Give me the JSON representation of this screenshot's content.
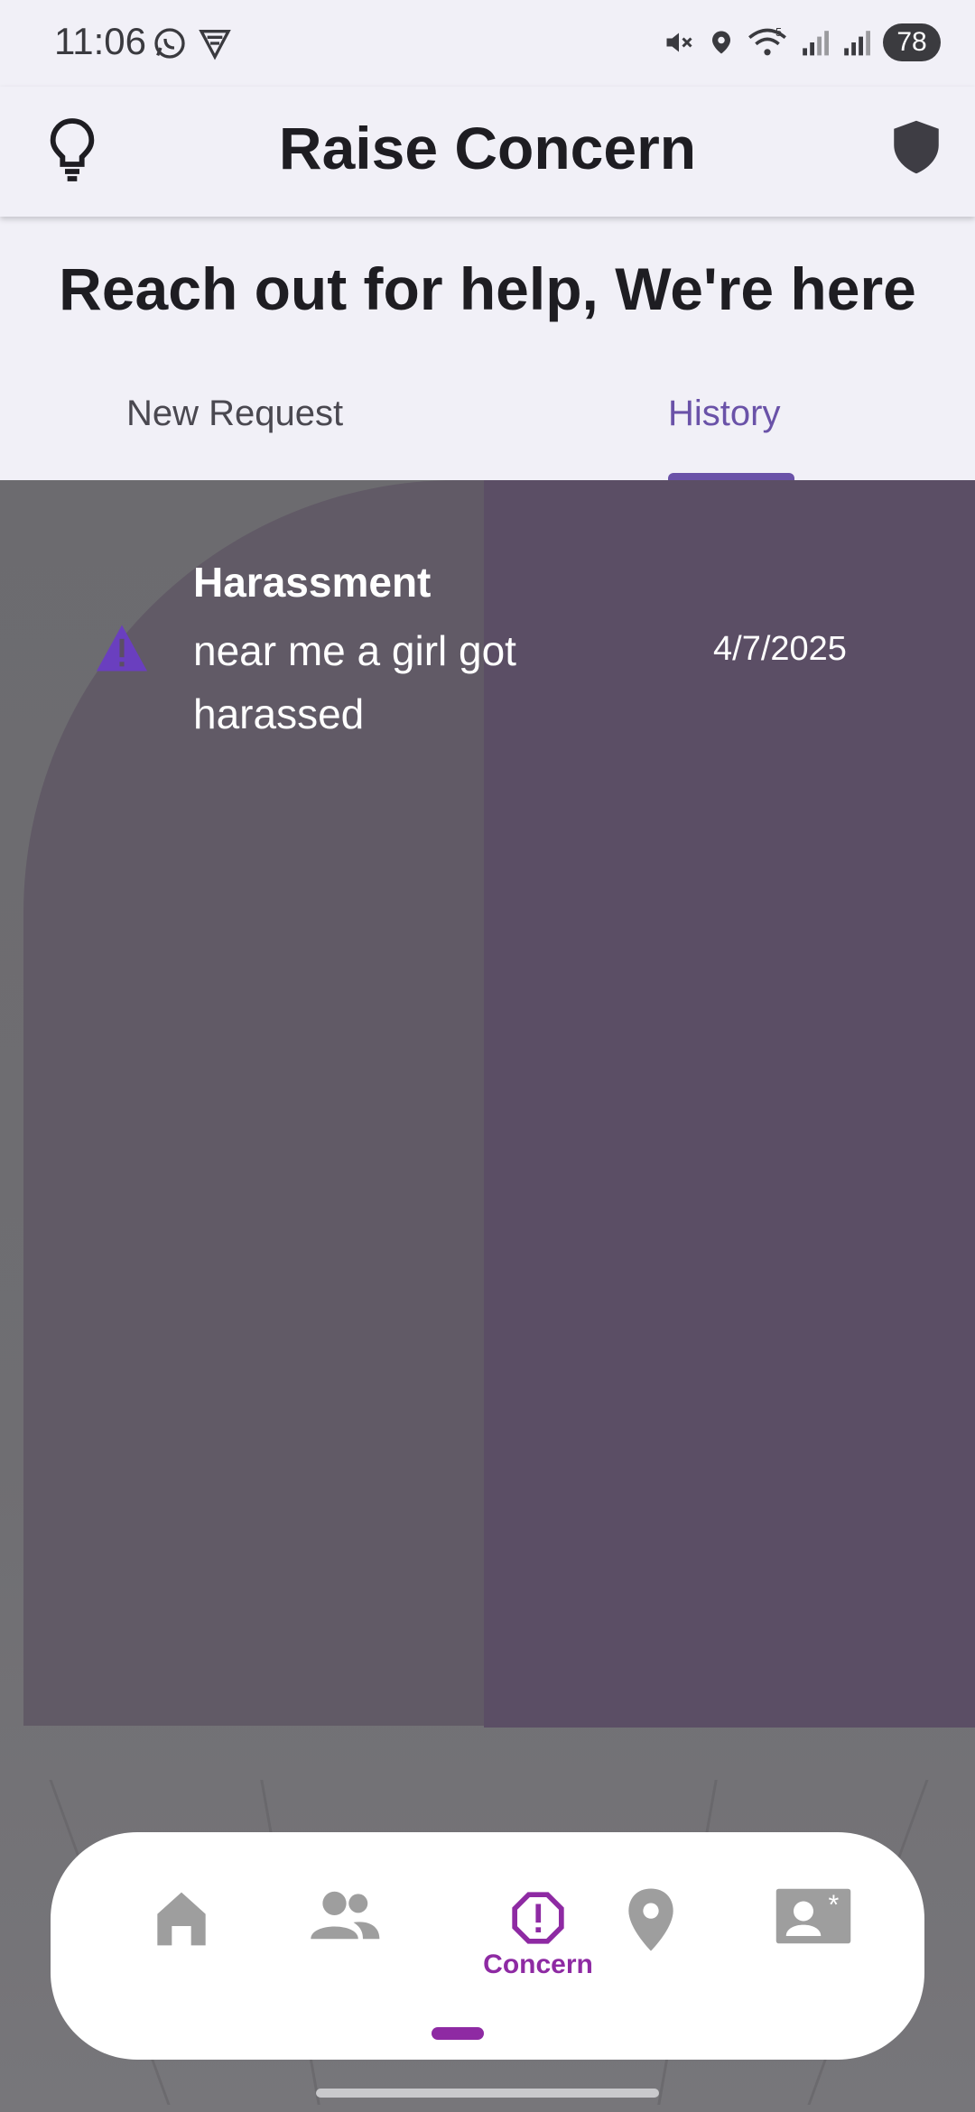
{
  "status_bar": {
    "time": "11:06",
    "battery": "78",
    "network_label": "5"
  },
  "app_bar": {
    "title": "Raise Concern"
  },
  "header": {
    "tagline": "Reach out for help, We're here"
  },
  "tabs": [
    {
      "label": "New Request",
      "selected": false
    },
    {
      "label": "History",
      "selected": true
    }
  ],
  "history": [
    {
      "category": "Harassment",
      "description": "near me a girl got harassed",
      "date": "4/7/2025",
      "icon": "warning-icon"
    }
  ],
  "bottom_nav": {
    "items": [
      {
        "icon": "home-icon",
        "label": ""
      },
      {
        "icon": "group-icon",
        "label": ""
      },
      {
        "icon": "alert-octagon-icon",
        "label": "Concern",
        "selected": true
      },
      {
        "icon": "location-pin-icon",
        "label": ""
      },
      {
        "icon": "contact-card-icon",
        "label": ""
      }
    ]
  },
  "colors": {
    "accent": "#6a52a8",
    "nav_selected": "#8e2aa3",
    "nav_unselected": "#9e9e9e",
    "surface": "#f1f0f7"
  }
}
